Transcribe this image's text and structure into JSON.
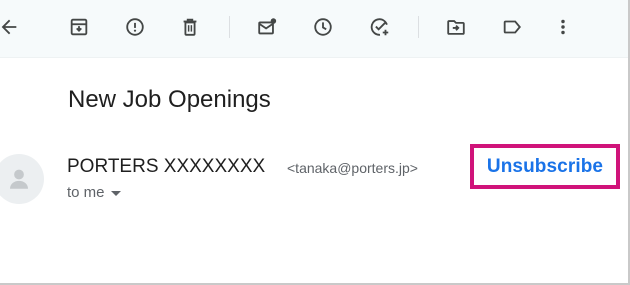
{
  "toolbar": {
    "icons": [
      "back-arrow-icon",
      "archive-icon",
      "report-spam-icon",
      "delete-icon",
      "mark-unread-icon",
      "snooze-icon",
      "add-to-tasks-icon",
      "move-to-icon",
      "label-icon",
      "more-vert-icon"
    ]
  },
  "email": {
    "subject": "New Job Openings",
    "sender_name": "PORTERS XXXXXXXX",
    "sender_email": "<tanaka@porters.jp>",
    "recipient": "to me",
    "unsubscribe_label": "Unsubscribe"
  },
  "colors": {
    "toolbar_bg": "#f6fafb",
    "icon": "#444746",
    "link": "#1a73e8",
    "highlight_border": "#d0137a",
    "avatar_bg": "#eceff1"
  }
}
